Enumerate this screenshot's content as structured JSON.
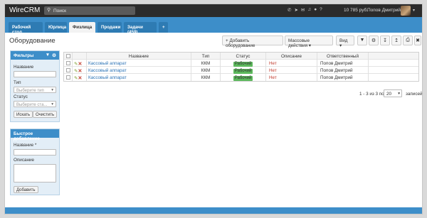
{
  "app": {
    "title": "WireCRM"
  },
  "search": {
    "placeholder": "Поиск"
  },
  "topbar": {
    "balance": "10 785 руб.",
    "user_name": "Попов Дмитрий"
  },
  "tabs": [
    {
      "label": "Рабочий стол"
    },
    {
      "label": "Юрлица"
    },
    {
      "label": "Физлица"
    },
    {
      "label": "Продажи"
    },
    {
      "label": "Задачи (459)"
    },
    {
      "label": "+"
    }
  ],
  "page": {
    "title": "Оборудование"
  },
  "toolbar": {
    "add_label": "Добавить оборудование",
    "mass_label": "Массовые действия",
    "view_label": "Вид"
  },
  "filters": {
    "title": "Фильтры",
    "name_label": "Название",
    "type_label": "Тип",
    "type_placeholder": "Выберите тип",
    "status_label": "Статус",
    "status_placeholder": "Выберите ста...",
    "search_button": "Искать",
    "clear_button": "Очистить"
  },
  "quick_add": {
    "title": "Быстрое добавление",
    "name_label": "Название *",
    "desc_label": "Описание",
    "add_button": "Добавить"
  },
  "table": {
    "columns": [
      "Название",
      "Тип",
      "Статус",
      "Описание",
      "Ответственный"
    ],
    "rows": [
      {
        "name": "Кассовый аппарат",
        "type": "ККМ",
        "status": "Рабочий",
        "desc": "Нет",
        "resp": "Попов Дмитрий"
      },
      {
        "name": "Кассовый аппарат",
        "type": "ККМ",
        "status": "Рабочий",
        "desc": "Нет",
        "resp": "Попов Дмитрий"
      },
      {
        "name": "Кассовый аппарат",
        "type": "ККМ",
        "status": "Рабочий",
        "desc": "Нет",
        "resp": "Попов Дмитрий"
      }
    ]
  },
  "pagination": {
    "info": "1 - 3 из 3 по",
    "per_page": "20",
    "records_label": "записей"
  },
  "colors": {
    "topbar": "#2b2b2b",
    "accent": "#3d8ec9",
    "status_green": "#5cb85c",
    "link": "#2a72b5",
    "danger": "#c0392b"
  }
}
